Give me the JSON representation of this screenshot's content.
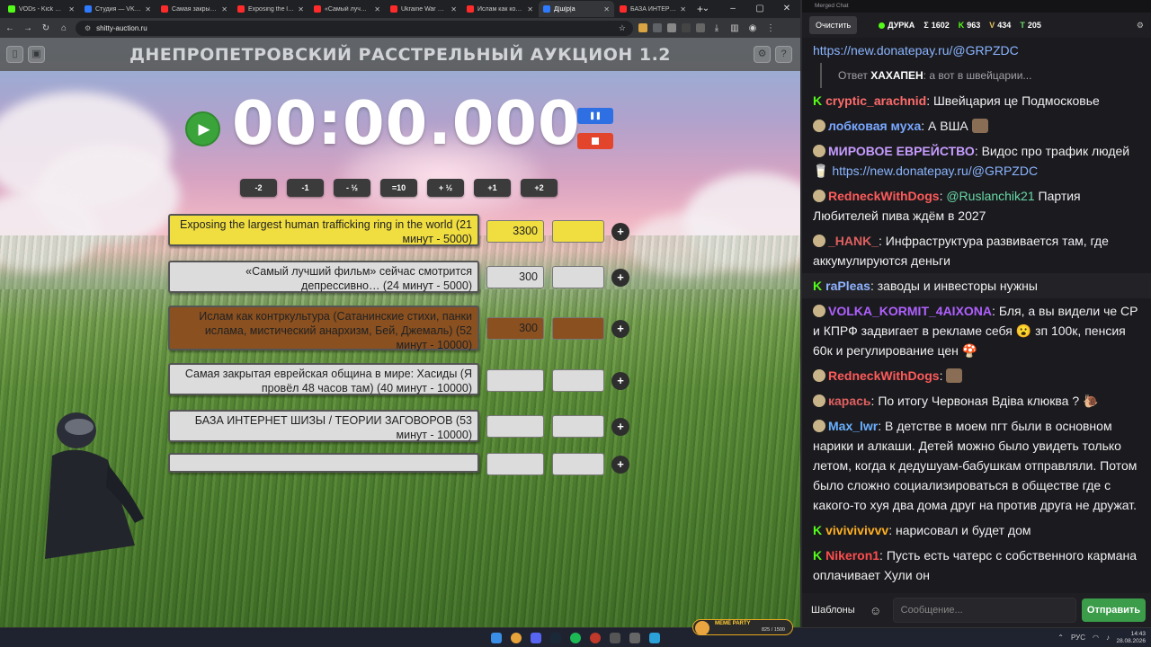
{
  "browser": {
    "tabs": [
      {
        "label": "VODs - Kick Dash",
        "icon": "kick",
        "active": false
      },
      {
        "label": "Студия — VK Видео",
        "icon": "vk",
        "active": false
      },
      {
        "label": "Самая закрытая е",
        "icon": "youtube",
        "active": false
      },
      {
        "label": "Exposing the larg",
        "icon": "youtube",
        "active": false
      },
      {
        "label": "«Самый лучший»",
        "icon": "youtube",
        "active": false
      },
      {
        "label": "Ukraine War Expo",
        "icon": "youtube",
        "active": false
      },
      {
        "label": "Ислам как контр",
        "icon": "youtube",
        "active": false
      },
      {
        "label": "Д|ш|р|а",
        "icon": "page",
        "active": true
      },
      {
        "label": "БАЗА ИНТЕРНЕТ",
        "icon": "youtube",
        "active": false
      }
    ],
    "url": "shitty-auction.ru"
  },
  "auction": {
    "title": "ДНЕПРОПЕТРОВСКИЙ РАССТРЕЛЬНЫЙ АУКЦИОН 1.2",
    "timer": "00:00.000",
    "adjust_buttons": [
      "-2",
      "-1",
      "- ½",
      "=10",
      "+ ½",
      "+1",
      "+2"
    ],
    "lots": [
      {
        "title": "Exposing the largest human trafficking ring in the world (21 минут - 5000)",
        "amount": "3300",
        "color": "yellow"
      },
      {
        "title": "«Самый лучший фильм» сейчас смотрится депрессивно… (24 минут - 5000)",
        "amount": "300",
        "color": "gray"
      },
      {
        "title": "Ислам как контркультура (Сатанинские стихи, панки ислама, мистический анархизм,  Бей, Джемаль) (52 минут - 10000)",
        "amount": "300",
        "color": "brown"
      },
      {
        "title": "Самая закрытая еврейская община в мире: Хасиды (Я провёл 48 часов там) (40 минут - 10000)",
        "amount": "",
        "color": "gray"
      },
      {
        "title": "БАЗА ИНТЕРНЕТ ШИЗЫ / ТЕОРИИ ЗАГОВОРОВ (53 минут - 10000)",
        "amount": "",
        "color": "gray"
      },
      {
        "title": "",
        "amount": "",
        "color": "gray"
      }
    ]
  },
  "chat": {
    "window_title": "Merged Chat",
    "clear_label": "Очистить",
    "channel": "ДУРКА",
    "stats": [
      {
        "symbol": "Σ",
        "value": "1602"
      },
      {
        "symbol": "K",
        "value": "963"
      },
      {
        "symbol": "V",
        "value": "434"
      },
      {
        "symbol": "T",
        "value": "205"
      }
    ],
    "messages": [
      {
        "user": "",
        "text": "https://new.donatepay.ru/@GRPZDC",
        "link": true
      },
      {
        "reply_prefix": "Ответ",
        "reply_user": "ХАХАПЕН",
        "reply_text": ": а вот в швейцарии..."
      },
      {
        "user": "cryptic_arachnid",
        "text": "Швейцария це Подмосковье",
        "color": "#ff6b6b",
        "badge": "kick"
      },
      {
        "user": "лобковая муха",
        "text": "А ВША",
        "color": "#7aa7ff",
        "badge": "vk"
      },
      {
        "user": "МИРОВОЕ ЕВРЕЙСТВО",
        "text": "Видос про трафик людей",
        "link_text": "https://new.donatepay.ru/@GRPZDC",
        "color": "#c79cff",
        "badge": "vk"
      },
      {
        "user": "RedneckWithDogs",
        "mention": "@Ruslanchik21",
        "text": "Партия Любителей пива ждём в 2027",
        "color": "#ff5a5a",
        "badge": "vk"
      },
      {
        "user": "_HANK_",
        "text": "Инфраструктура развивается там, где аккумулируются деньги",
        "color": "#e06060",
        "badge": "vk"
      },
      {
        "user": "raPleas",
        "text": "заводы и инвесторы нужны",
        "color": "#8fb3ff",
        "badge": "kick"
      },
      {
        "user": "VOLKA_KORMIT_4AIXONA",
        "text": "Бля, а вы видели че СР и КПРФ задвигает в рекламе себя",
        "text2": "зп 100к, пенсия 60к и регулирование цен",
        "color": "#b060ff",
        "badge": "vk"
      },
      {
        "user": "RedneckWithDogs",
        "text": "",
        "color": "#ff5a5a",
        "badge": "vk"
      },
      {
        "user": "карась",
        "text": "По итогу Червоная Вдiва клюква ?",
        "color": "#e06060",
        "badge": "vk"
      },
      {
        "user": "Max_lwr",
        "text": "В детстве в моем пгт были в основном нарики и алкаши. Детей можно было увидеть только летом, когда к дедушуам-бабушкам отправляли. Потом было сложно социализироваться в обществе где с какого-то хуя два дома друг на против друга не дружат.",
        "color": "#6ab0ff",
        "badge": "vk"
      },
      {
        "user": "vivivivivvv",
        "text": "нарисовал и будет дом",
        "color": "#ffb020",
        "badge": "kick"
      },
      {
        "user": "Nikeron1",
        "text": "Пусть есть чатерс с собственного кармана оплачивает Хули он",
        "color": "#ff4d4d",
        "badge": "kick"
      }
    ],
    "templates_label": "Шаблоны",
    "input_placeholder": "Сообщение...",
    "send_label": "Отправить"
  },
  "taskbar": {
    "badge_label": "MEME PARTY",
    "badge_count": "825 / 1500",
    "lang": "РУС",
    "time": "14:43",
    "date": "28.08.2026"
  }
}
